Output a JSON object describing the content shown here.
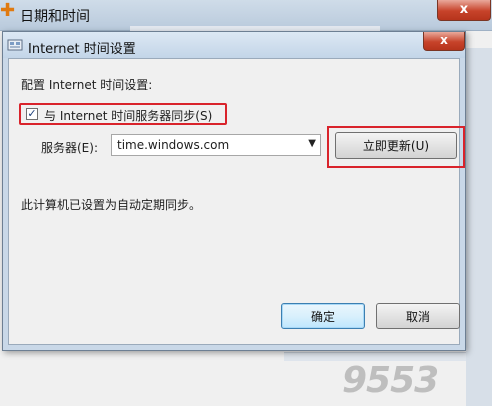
{
  "parent_window": {
    "title": "日期和时间",
    "close_glyph": "x"
  },
  "dialog": {
    "title": "Internet 时间设置",
    "close_glyph": "x",
    "config_label": "配置 Internet 时间设置:",
    "sync_checkbox": {
      "checked": true,
      "label": "与 Internet 时间服务器同步(S)"
    },
    "server_label": "服务器(E):",
    "server_value": "time.windows.com",
    "update_button": "立即更新(U)",
    "status_text": "此计算机已设置为自动定期同步。",
    "ok_button": "确定",
    "cancel_button": "取消"
  },
  "watermark": "9553",
  "colors": {
    "highlight_box": "#d9232b",
    "dialog_frame": "#c9d8e8",
    "close_button": "#c7432a"
  }
}
